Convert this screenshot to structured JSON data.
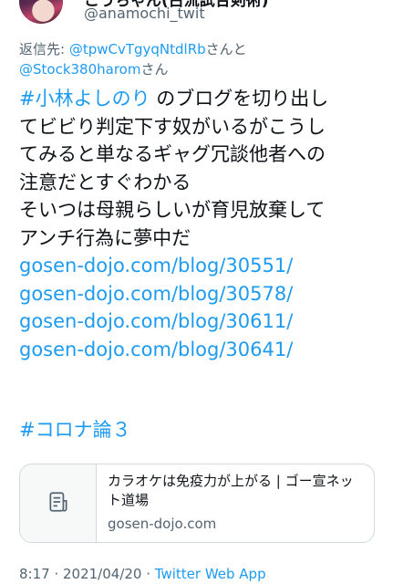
{
  "author": {
    "display_name": "こうちゃん(古流試合剣術)",
    "handle": "@anamochi_twit"
  },
  "reply": {
    "prefix": "返信先: ",
    "user1": "@tpwCvTgyqNtdlRb",
    "conj": "さんと",
    "user2": "@Stock380harom",
    "suffix": "さん"
  },
  "tweet": {
    "hashtag1": "#小林よしのり",
    "line1_rest": "のブログを切り出し",
    "line2": "てビビり判定下す奴がいるがこうし",
    "line3": "てみると単なるギャグ冗談他者への",
    "line4": "注意だとすぐわかる",
    "line5": "そいつは母親らしいが育児放棄して",
    "line6": "アンチ行為に夢中だ",
    "links": [
      "gosen-dojo.com/blog/30551/",
      "gosen-dojo.com/blog/30578/",
      "gosen-dojo.com/blog/30611/",
      "gosen-dojo.com/blog/30641/"
    ],
    "hashtag2": "#コロナ論３"
  },
  "card": {
    "title": "カラオケは免疫力が上がる | ゴー宣ネット道場",
    "domain": "gosen-dojo.com",
    "icon": "document-icon"
  },
  "meta": {
    "time": "8:17",
    "sep1": " · ",
    "date": "2021/04/20",
    "sep2": " · ",
    "source": "Twitter Web App"
  },
  "colors": {
    "link": "#1d9bf0",
    "muted": "#536471",
    "border": "#cfd9de"
  }
}
